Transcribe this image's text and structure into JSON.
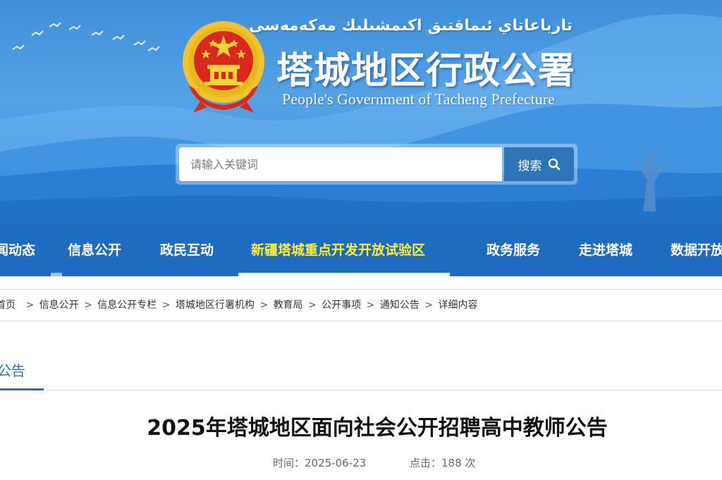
{
  "header": {
    "uyghur_title": "تارباعاتاي ئىماقتىق اكىمشىلىك مەكەمەسى",
    "cn_title": "塔城地区行政公署",
    "en_title": "People's  Government of Tacheng Prefecture",
    "emblem_icon": "national-emblem-icon"
  },
  "search": {
    "placeholder": "请输入关键词",
    "button_label": "搜索",
    "button_icon": "search-icon"
  },
  "nav": {
    "items": [
      {
        "label": "新闻动态"
      },
      {
        "label": "信息公开"
      },
      {
        "label": "政民互动"
      },
      {
        "label": "新疆塔城重点开发开放试验区",
        "active": true
      },
      {
        "label": "政务服务"
      },
      {
        "label": "走进塔城"
      },
      {
        "label": "数据开放"
      }
    ]
  },
  "breadcrumb": {
    "items": [
      "首页",
      "信息公开",
      "信息公开专栏",
      "塔城地区行署机构",
      "教育局",
      "公开事项",
      "通知公告",
      "详细内容"
    ],
    "separator": ">"
  },
  "section": {
    "tab_label": "公告"
  },
  "article": {
    "title": "2025年塔城地区面向社会公开招聘高中教师公告",
    "time_label": "时间：",
    "time_value": "2025-06-23",
    "views_label": "点击：",
    "views_value": "188",
    "views_unit": "次"
  },
  "colors": {
    "nav_bg": "#1e6bc0",
    "nav_active_text": "#ffee33",
    "accent": "#2e6fb7",
    "search_button": "#2e75b8"
  }
}
